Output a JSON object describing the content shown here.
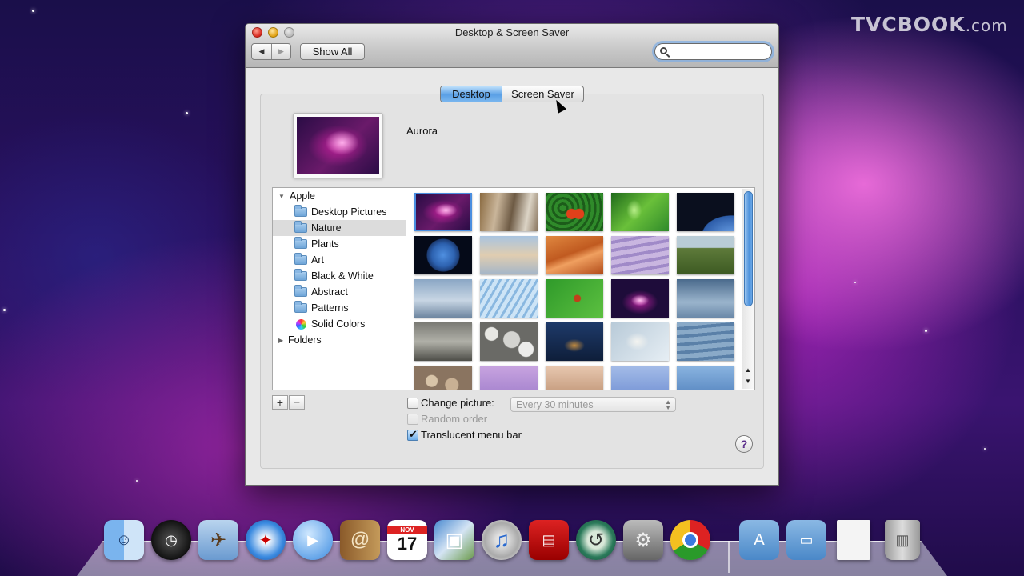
{
  "watermark": {
    "brand": "TVCBOOK",
    "suffix": ".com"
  },
  "window": {
    "title": "Desktop & Screen Saver",
    "show_all": "Show All",
    "search_placeholder": ""
  },
  "tabs": {
    "desktop": "Desktop",
    "screen_saver": "Screen Saver",
    "selected": "Desktop"
  },
  "current_picture": "Aurora",
  "source_list": {
    "apple": "Apple",
    "items": [
      "Desktop Pictures",
      "Nature",
      "Plants",
      "Art",
      "Black & White",
      "Abstract",
      "Patterns",
      "Solid Colors"
    ],
    "selected": "Nature",
    "folders": "Folders"
  },
  "buttons": {
    "add": "+",
    "remove": "−",
    "help": "?"
  },
  "options": {
    "change_picture": "Change picture:",
    "change_picture_checked": false,
    "interval": "Every 30 minutes",
    "random_order": "Random order",
    "random_order_checked": false,
    "translucent_menu_bar": "Translucent menu bar",
    "translucent_menu_bar_checked": true
  },
  "dock": {
    "icons": [
      "finder-icon",
      "dashboard-icon",
      "mail-icon",
      "safari-icon",
      "ichat-icon",
      "address-book-icon",
      "ical-icon",
      "iphoto-icon",
      "itunes-icon",
      "photo-booth-icon",
      "time-machine-icon",
      "system-preferences-icon",
      "chrome-icon",
      "applications-folder-icon",
      "documents-folder-icon",
      "file-icon",
      "trash-icon"
    ],
    "calendar_month": "NOV",
    "calendar_day": "17"
  },
  "colors": {
    "accent_blue": "#5aa0e6",
    "wallpaper_magenta": "#c0209a"
  }
}
